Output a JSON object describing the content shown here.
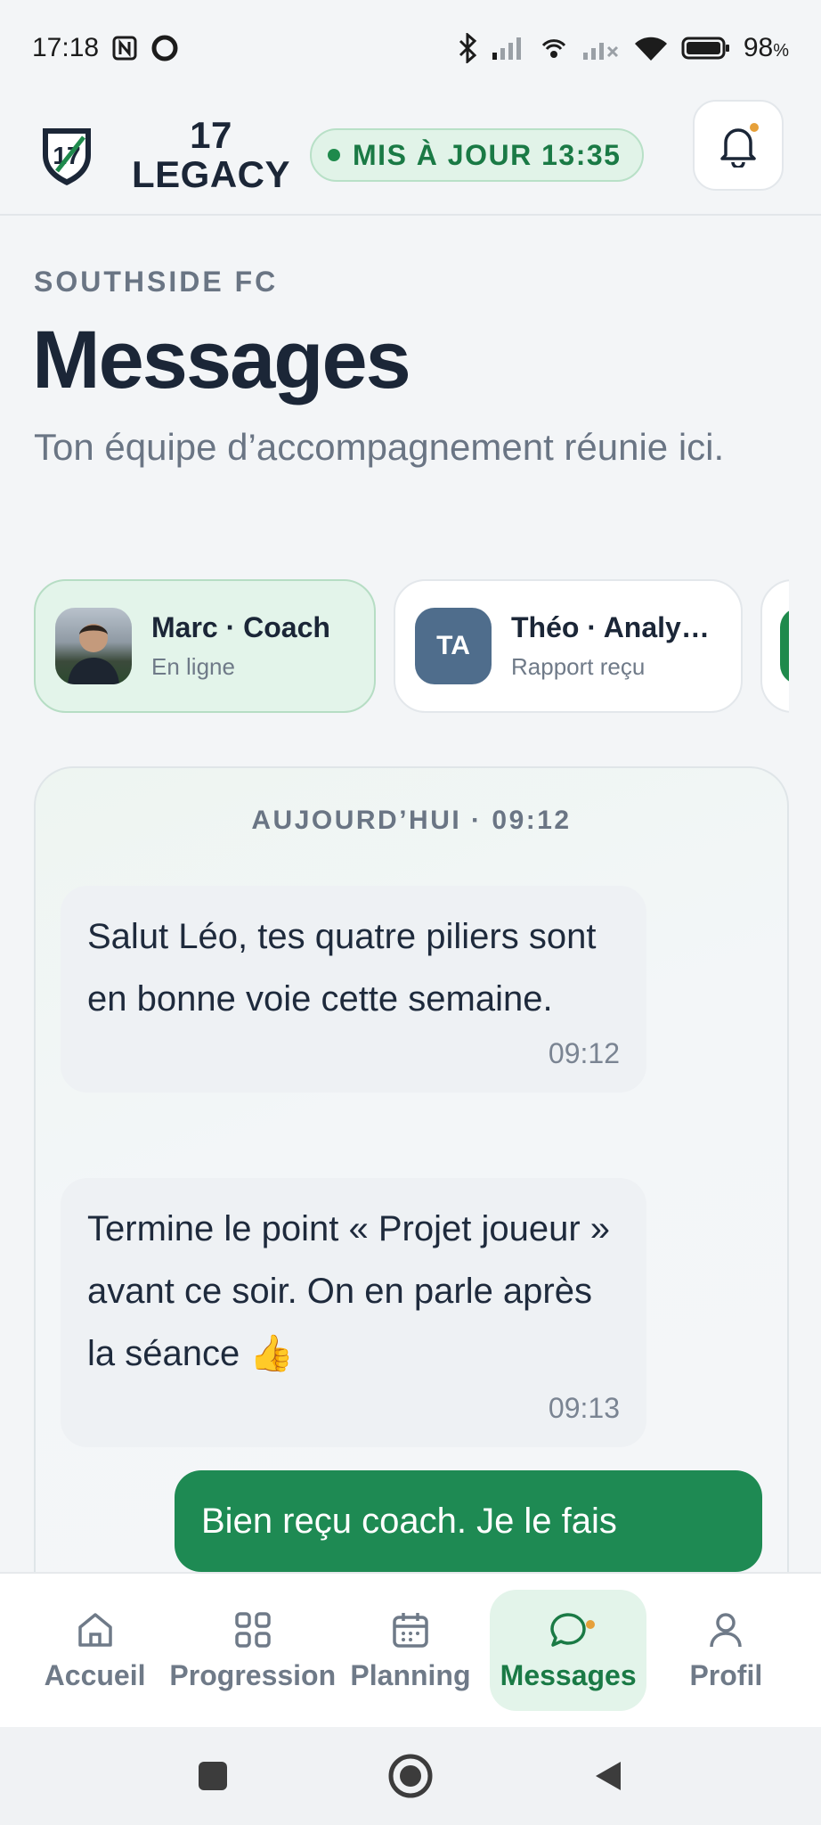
{
  "status_bar": {
    "time": "17:18",
    "battery": "98",
    "battery_unit": "%",
    "icons": [
      "nfc-icon",
      "record-icon",
      "bluetooth-icon",
      "signal-icon",
      "hotspot-icon",
      "signal-weak-icon",
      "wifi-icon",
      "battery-icon"
    ]
  },
  "header": {
    "brand_line1": "17",
    "brand_line2": "LEGACY",
    "update_pill": "MIS À JOUR 13:35",
    "has_notification": true,
    "colors": {
      "accent": "#1a7a45",
      "notification_dot": "#e6a03a"
    }
  },
  "page": {
    "team": "SOUTHSIDE FC",
    "title": "Messages",
    "subtitle": "Ton équipe d’accompagnement réunie ici."
  },
  "contacts": [
    {
      "name": "Marc · Coach",
      "status": "En ligne",
      "avatar": "photo",
      "active": true
    },
    {
      "name": "Théo · Analyste",
      "status": "Rapport reçu",
      "initials": "TA",
      "active": false
    }
  ],
  "chat": {
    "day_label": "AUJOURD’HUI · 09:12",
    "messages": [
      {
        "direction": "incoming",
        "text": "Salut Léo, tes quatre piliers sont en bonne voie cette semaine.",
        "time": "09:12"
      },
      {
        "direction": "incoming",
        "text": "Termine le point « Projet joueur » avant ce soir. On en parle après la séance 👍",
        "time": "09:13"
      },
      {
        "direction": "outgoing",
        "text": "Bien reçu coach. Je le fais"
      }
    ]
  },
  "bottom_nav": [
    {
      "label": "Accueil",
      "icon": "home-icon"
    },
    {
      "label": "Progression",
      "icon": "grid-icon"
    },
    {
      "label": "Planning",
      "icon": "calendar-icon"
    },
    {
      "label": "Messages",
      "icon": "chat-bubble-icon",
      "active": true,
      "badge": true
    },
    {
      "label": "Profil",
      "icon": "user-icon"
    }
  ]
}
